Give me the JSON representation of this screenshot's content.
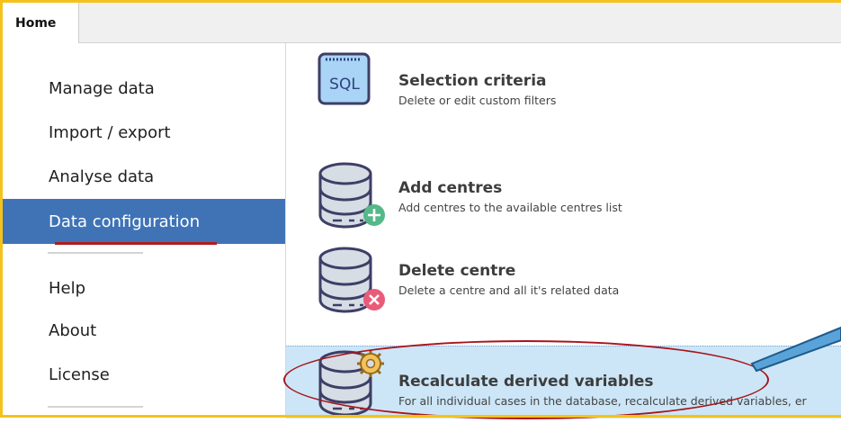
{
  "tabs": {
    "home": "Home"
  },
  "sidebar": {
    "items": [
      {
        "label": "Manage data"
      },
      {
        "label": "Import / export"
      },
      {
        "label": "Analyse data"
      },
      {
        "label": "Data configuration"
      },
      {
        "label": "Help"
      },
      {
        "label": "About"
      },
      {
        "label": "License"
      }
    ],
    "selected": "Data configuration"
  },
  "actions": [
    {
      "title": "Selection criteria",
      "description": "Delete or edit custom filters",
      "icon": "sql-icon",
      "icon_text": "SQL"
    },
    {
      "title": "Add centres",
      "description": "Add centres to the available centres list",
      "icon": "database-add-icon"
    },
    {
      "title": "Delete centre",
      "description": "Delete a centre and all it's related data",
      "icon": "database-delete-icon"
    },
    {
      "title": "Recalculate derived variables",
      "description": "For all individual cases in the database, recalculate derived variables, er",
      "icon": "database-gear-icon",
      "highlighted": true
    }
  ],
  "colors": {
    "frame": "#f5c21b",
    "selected_nav": "#3f73b6",
    "highlight_row": "#cce6f7",
    "annotation_red": "#a8141c",
    "arrow": "#5aa3d8"
  }
}
